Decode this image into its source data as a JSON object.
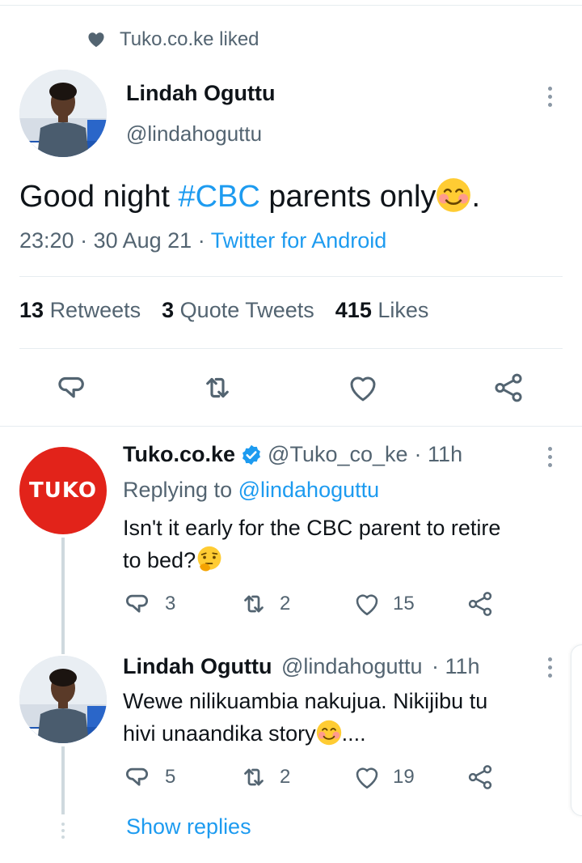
{
  "social_context": {
    "icon": "heart-icon",
    "text": "Tuko.co.ke liked"
  },
  "main_tweet": {
    "author_name": "Lindah Oguttu",
    "author_handle": "@lindahoguttu",
    "text_before": "Good night ",
    "hashtag": "#CBC",
    "text_after": " parents only",
    "trailing": ".",
    "time": "23:20",
    "date": "30 Aug 21",
    "source": "Twitter for Android",
    "retweets_count": "13",
    "retweets_label": "Retweets",
    "quotes_count": "3",
    "quotes_label": "Quote Tweets",
    "likes_count": "415",
    "likes_label": "Likes"
  },
  "replies": [
    {
      "author_name": "Tuko.co.ke",
      "author_handle": "@Tuko_co_ke",
      "time": "· 11h",
      "replying_prefix": "Replying to ",
      "replying_to": "@lindahoguttu",
      "line1": "Isn't it early for the CBC parent to retire",
      "line2": "to bed?",
      "reply_count": "3",
      "retweet_count": "2",
      "like_count": "15",
      "avatar_text": "TUKO"
    },
    {
      "author_name": "Lindah Oguttu",
      "author_handle": "@lindahoguttu",
      "time": "· 11h",
      "line1": "Wewe nilikuambia nakujua. Nikijibu tu",
      "line2": "hivi unaandika story",
      "line2_after": "....",
      "reply_count": "5",
      "retweet_count": "2",
      "like_count": "19"
    }
  ],
  "show_replies": "Show replies",
  "colors": {
    "accent": "#1d9bf0",
    "tuko_red": "#e2231a",
    "text": "#0f1419",
    "secondary": "#536471"
  }
}
